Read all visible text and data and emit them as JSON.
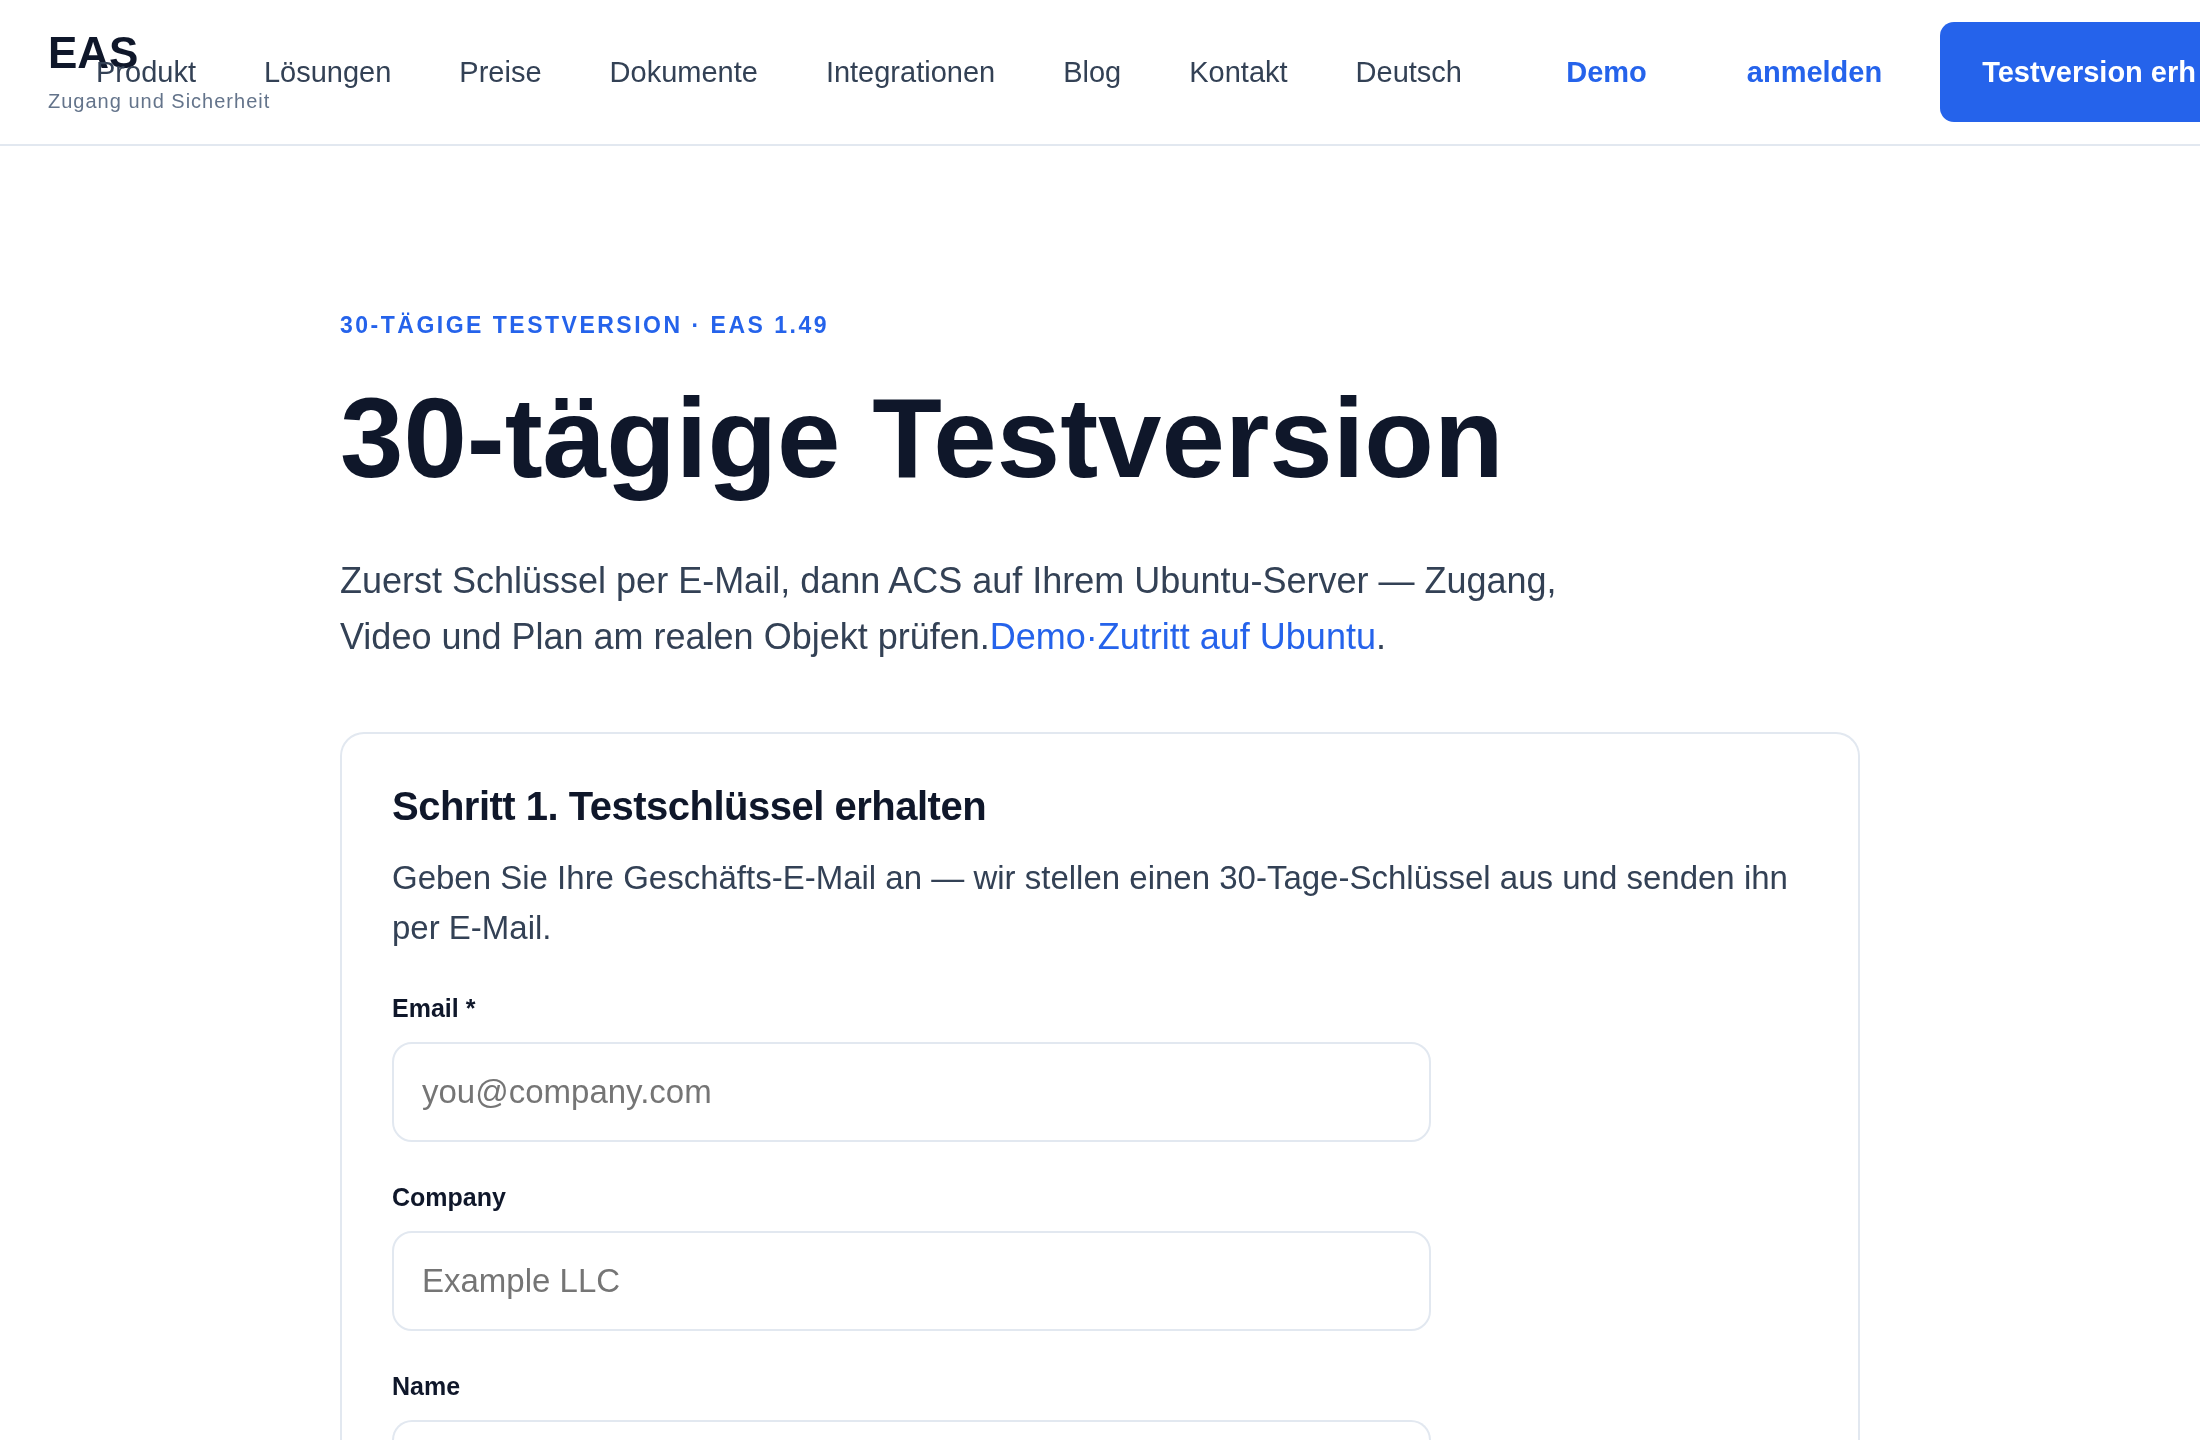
{
  "header": {
    "logo": {
      "title": "EAS",
      "subtitle": "Zugang und Sicherheit"
    },
    "nav": [
      "Produkt",
      "Lösungen",
      "Preise",
      "Dokumente",
      "Integrationen",
      "Blog",
      "Kontakt",
      "Deutsch"
    ],
    "actions": [
      {
        "label": "Demo",
        "kind": "link"
      },
      {
        "label": "anmelden",
        "kind": "link"
      },
      {
        "label": "Testversion erh",
        "kind": "button"
      }
    ]
  },
  "hero": {
    "eyebrow": "30-TÄGIGE TESTVERSION · EAS 1.49",
    "title": "30-tägige Testversion",
    "intro": {
      "text": "Zuerst Schlüssel per E-Mail, dann ACS auf Ihrem Ubuntu-Server — Zugang, Video und Plan am realen Objekt prüfen.",
      "link": "Demo·Zutritt auf Ubuntu",
      "after": "."
    }
  },
  "card": {
    "title": "Schritt 1. Testschlüssel erhalten",
    "description": "Geben Sie Ihre Geschäfts-E-Mail an — wir stellen einen 30-Tage-Schlüssel aus und senden ihn per E-Mail.",
    "fields": [
      {
        "label": "Email *",
        "placeholder": "you@company.com"
      },
      {
        "label": "Company",
        "placeholder": "Example LLC"
      },
      {
        "label": "Name"
      }
    ]
  }
}
